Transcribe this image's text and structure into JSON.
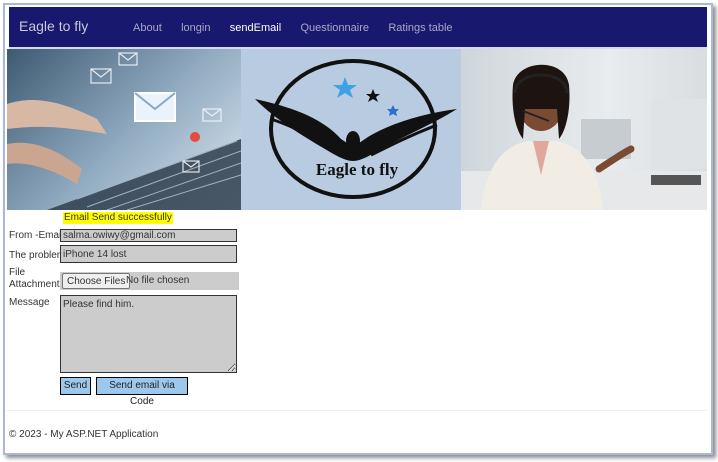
{
  "navbar": {
    "brand": "Eagle to fly",
    "links": [
      "About",
      "longin",
      "sendEmail",
      "Questionnaire",
      "Ratings table"
    ],
    "active": "sendEmail"
  },
  "banner": {
    "logo_text": "Eagle to fly"
  },
  "form": {
    "status_message": "Email Send successfully",
    "from_label": "From -Email",
    "from_value": "salma.owiwy@gmail.com",
    "problem_label": "The problem",
    "problem_value": "iPhone 14 lost",
    "file_label_1": "File",
    "file_label_2": "Attachments",
    "choose_files": "Choose Files",
    "no_file": "No file chosen",
    "message_label": "Message",
    "message_value": "Please find him.",
    "send_label": "Send",
    "send_code_label": "Send email via Code"
  },
  "footer": {
    "text": "© 2023 - My ASP.NET Application"
  },
  "colors": {
    "navbar": "#17186e",
    "highlight": "#ffff00",
    "button": "#9cc8ee",
    "field": "#cccccc"
  }
}
